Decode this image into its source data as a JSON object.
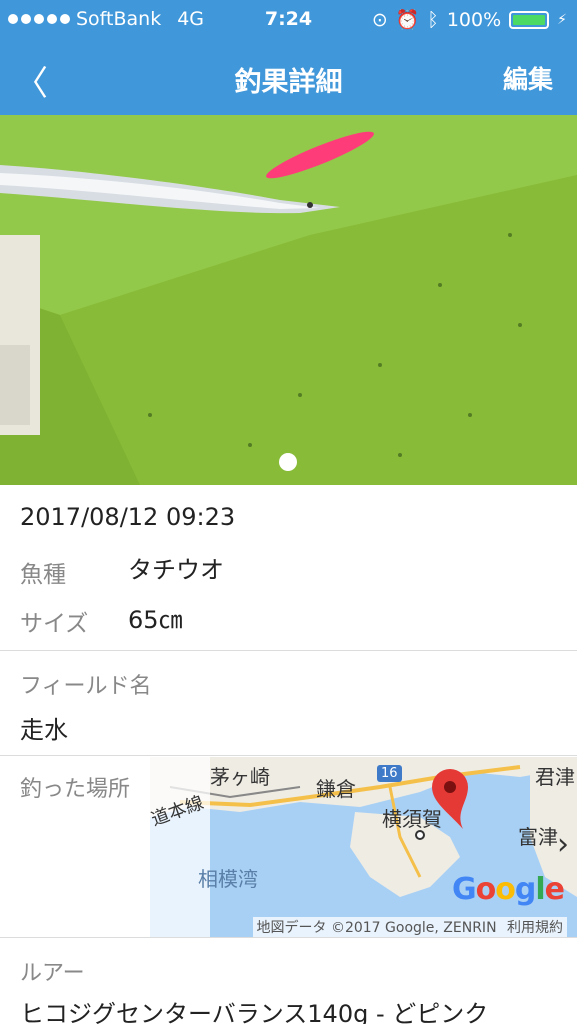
{
  "status_bar": {
    "carrier": "SoftBank",
    "network": "4G",
    "time": "7:24",
    "battery": "100%"
  },
  "nav": {
    "back_label": "〈",
    "title": "釣果詳細",
    "edit_label": "編集"
  },
  "photo": {
    "page_count": 1,
    "current_page": 1
  },
  "detail": {
    "datetime": "2017/08/12 09:23",
    "fish_label": "魚種",
    "fish_value": "タチウオ",
    "size_label": "サイズ",
    "size_value": "65㎝"
  },
  "field": {
    "label": "フィールド名",
    "value": "走水"
  },
  "location": {
    "label": "釣った場所",
    "map_places": {
      "chigasaki": "茅ヶ崎",
      "kamakura": "鎌倉",
      "yokosuka": "横須賀",
      "sagami_bay": "相模湾",
      "road_16": "16",
      "tomitsu": "富津",
      "kimitsu": "君津",
      "honsen": "道本線"
    },
    "map_credit": "地図データ ©2017 Google, ZENRIN",
    "map_terms": "利用規約",
    "google_logo": "Google"
  },
  "lure": {
    "label": "ルアー",
    "value": "ヒコジグセンターバランス140g - どピンク"
  },
  "colors": {
    "header_blue": "#4097d9",
    "photo_green": "#8fc23f",
    "pin_red": "#e53935",
    "sea_blue": "#a8d0f5"
  }
}
